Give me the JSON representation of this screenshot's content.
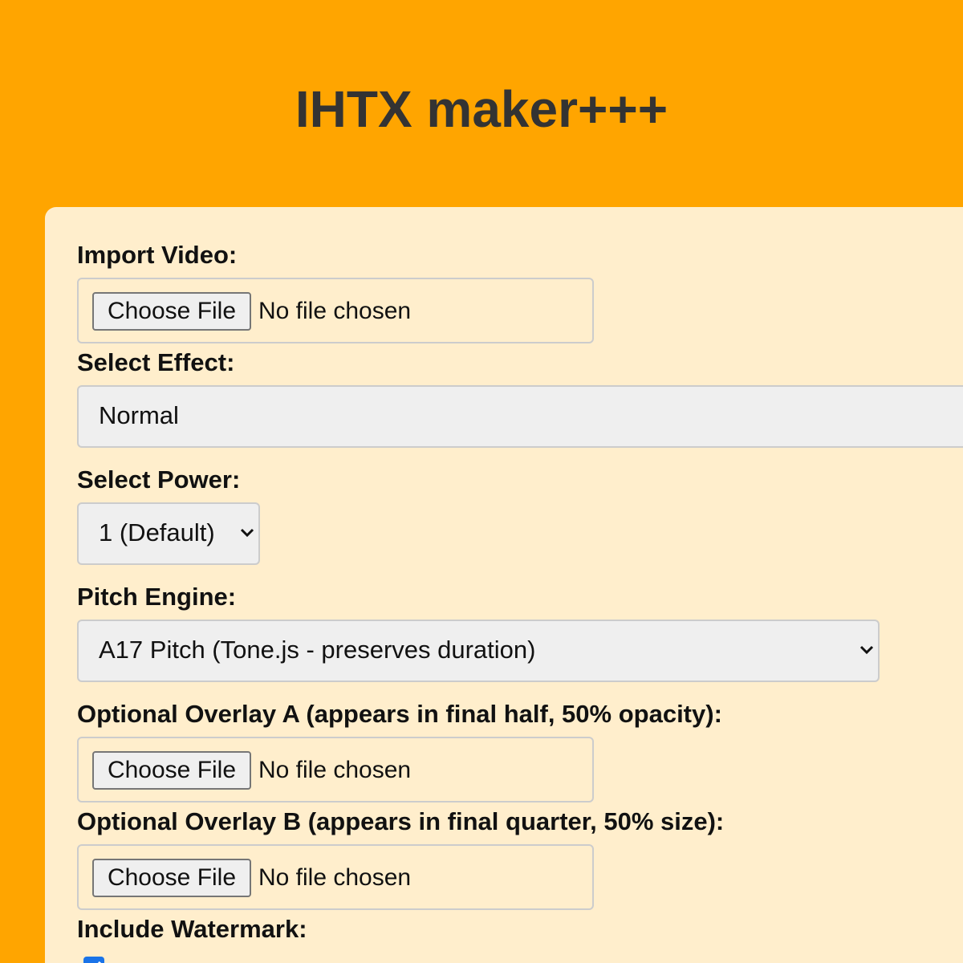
{
  "app": {
    "title": "IHTX maker+++"
  },
  "form": {
    "import_video": {
      "label": "Import Video:",
      "button_label": "Choose File",
      "status": "No file chosen"
    },
    "effect": {
      "label": "Select Effect:",
      "selected": "Normal"
    },
    "power": {
      "label": "Select Power:",
      "selected": "1 (Default)"
    },
    "pitch_engine": {
      "label": "Pitch Engine:",
      "selected": "A17 Pitch (Tone.js - preserves duration)"
    },
    "overlay_a": {
      "label": "Optional Overlay A (appears in final half, 50% opacity):",
      "button_label": "Choose File",
      "status": "No file chosen"
    },
    "overlay_b": {
      "label": "Optional Overlay B (appears in final quarter, 50% size):",
      "button_label": "Choose File",
      "status": "No file chosen"
    },
    "watermark": {
      "label": "Include Watermark:",
      "checked": true
    }
  },
  "colors": {
    "background": "#ffa500",
    "panel": "#ffeecc",
    "title": "#333333",
    "checkbox_accent": "#1a73e8"
  },
  "icons": {
    "select_arrow": "chevron-down-icon",
    "checkbox_mark": "checkmark-icon"
  }
}
